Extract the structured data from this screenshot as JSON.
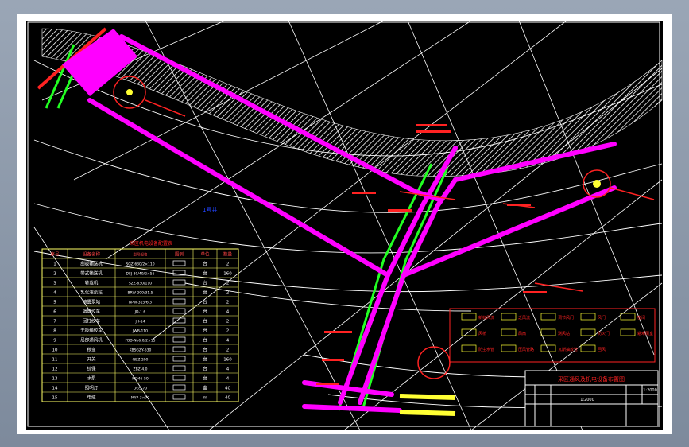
{
  "drawing": {
    "area_label": "1号井",
    "annotations": [
      "总回风巷",
      "运输大巷",
      "轨道巷"
    ]
  },
  "equipment_table": {
    "title": "采区机电设备配置表",
    "headers": [
      "序号",
      "设备名称",
      "型号规格",
      "图例",
      "单位",
      "数量"
    ],
    "rows": [
      {
        "no": "1",
        "name": "刮板输送机",
        "model": "SGZ-630/2×110",
        "unit": "台",
        "qty": "2"
      },
      {
        "no": "2",
        "name": "带式输送机",
        "model": "DSJ-80/40/2×55",
        "unit": "台",
        "qty": "160"
      },
      {
        "no": "3",
        "name": "转载机",
        "model": "SZZ-630/110",
        "unit": "台",
        "qty": "2"
      },
      {
        "no": "4",
        "name": "乳化液泵站",
        "model": "BRW-200/31.5",
        "unit": "台",
        "qty": "2"
      },
      {
        "no": "5",
        "name": "喷雾泵站",
        "model": "BPW-315/6.3",
        "unit": "台",
        "qty": "2"
      },
      {
        "no": "6",
        "name": "调度绞车",
        "model": "JD-1.6",
        "unit": "台",
        "qty": "4"
      },
      {
        "no": "7",
        "name": "回柱绞车",
        "model": "JH-14",
        "unit": "台",
        "qty": "2"
      },
      {
        "no": "8",
        "name": "无极绳绞车",
        "model": "JWB-110",
        "unit": "台",
        "qty": "2"
      },
      {
        "no": "9",
        "name": "局部通风机",
        "model": "FBD-No6.0/2×15",
        "unit": "台",
        "qty": "4"
      },
      {
        "no": "10",
        "name": "移变",
        "model": "KBSGZY-630",
        "unit": "台",
        "qty": "2"
      },
      {
        "no": "11",
        "name": "开关",
        "model": "QBZ-200",
        "unit": "台",
        "qty": "160"
      },
      {
        "no": "12",
        "name": "综保",
        "model": "ZBZ-4.0",
        "unit": "台",
        "qty": "4"
      },
      {
        "no": "13",
        "name": "水泵",
        "model": "MD46-50",
        "unit": "台",
        "qty": "4"
      },
      {
        "no": "14",
        "name": "照明灯",
        "model": "DGS-70",
        "unit": "盏",
        "qty": "40"
      },
      {
        "no": "15",
        "name": "电缆",
        "model": "MYP-3×70",
        "unit": "m",
        "qty": "40"
      }
    ]
  },
  "legend": {
    "items": [
      "新鲜风流",
      "乏风流",
      "调节风门",
      "风门",
      "密闭",
      "风桥",
      "局扇",
      "测风站",
      "防火门",
      "避难硐室",
      "防尘水管",
      "压风管路",
      "瓦斯抽放管",
      "回风"
    ]
  },
  "title_block": {
    "title": "采区通风及机电设备布置图",
    "subtitle": "1:2000",
    "scale": "1:2000",
    "fields": [
      "设计",
      "制图",
      "审核",
      "日期"
    ]
  },
  "colors": {
    "roadway": "#ff00ff",
    "green_line": "#22ff22",
    "annotation_red": "#ff2222",
    "yellow": "#ffff33",
    "table_line": "#ffff66",
    "contour": "#ffffff",
    "background": "#000000"
  }
}
